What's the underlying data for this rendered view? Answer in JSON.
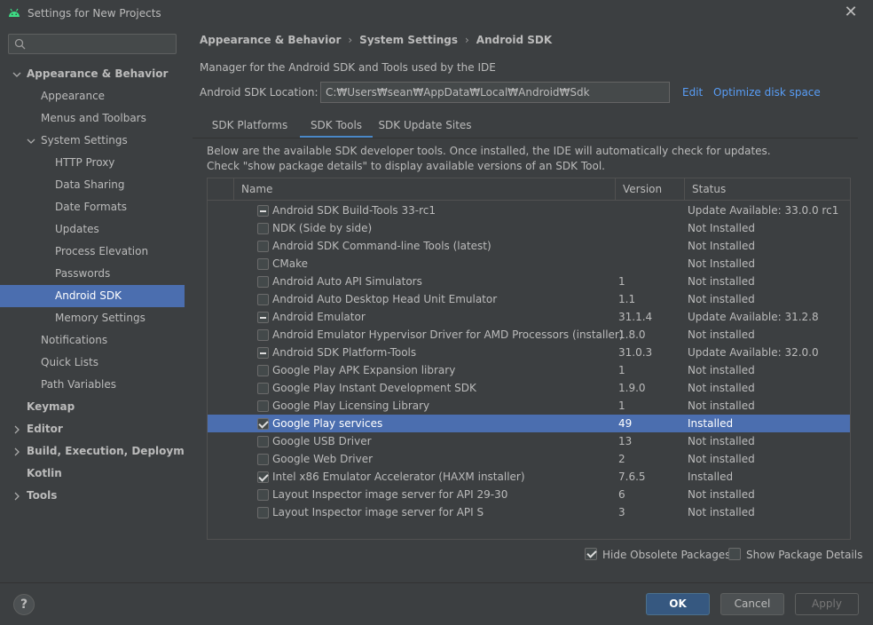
{
  "window": {
    "title": "Settings for New Projects"
  },
  "sidebar": {
    "items": [
      {
        "label": "Appearance & Behavior",
        "level": 0,
        "bold": true,
        "arrow": "down"
      },
      {
        "label": "Appearance",
        "level": 1
      },
      {
        "label": "Menus and Toolbars",
        "level": 1
      },
      {
        "label": "System Settings",
        "level": 1,
        "arrow": "down"
      },
      {
        "label": "HTTP Proxy",
        "level": 2
      },
      {
        "label": "Data Sharing",
        "level": 2
      },
      {
        "label": "Date Formats",
        "level": 2
      },
      {
        "label": "Updates",
        "level": 2
      },
      {
        "label": "Process Elevation",
        "level": 2
      },
      {
        "label": "Passwords",
        "level": 2
      },
      {
        "label": "Android SDK",
        "level": 2,
        "selected": true
      },
      {
        "label": "Memory Settings",
        "level": 2
      },
      {
        "label": "Notifications",
        "level": 1
      },
      {
        "label": "Quick Lists",
        "level": 1
      },
      {
        "label": "Path Variables",
        "level": 1
      },
      {
        "label": "Keymap",
        "level": 0,
        "bold": true
      },
      {
        "label": "Editor",
        "level": 0,
        "bold": true,
        "arrow": "right"
      },
      {
        "label": "Build, Execution, Deployment",
        "level": 0,
        "bold": true,
        "arrow": "right"
      },
      {
        "label": "Kotlin",
        "level": 0,
        "bold": true
      },
      {
        "label": "Tools",
        "level": 0,
        "bold": true,
        "arrow": "right"
      }
    ]
  },
  "breadcrumb": [
    "Appearance & Behavior",
    "System Settings",
    "Android SDK"
  ],
  "description": "Manager for the Android SDK and Tools used by the IDE",
  "sdk_location": {
    "label": "Android SDK Location:",
    "value": "C:₩Users₩sean₩AppData₩Local₩Android₩Sdk",
    "edit": "Edit",
    "optimize": "Optimize disk space"
  },
  "tabs": [
    {
      "label": "SDK Platforms",
      "active": false
    },
    {
      "label": "SDK Tools",
      "active": true
    },
    {
      "label": "SDK Update Sites",
      "active": false
    }
  ],
  "hint_lines": [
    "Below are the available SDK developer tools. Once installed, the IDE will automatically check for updates.",
    "Check \"show package details\" to display available versions of an SDK Tool."
  ],
  "table": {
    "columns": [
      "Name",
      "Version",
      "Status"
    ],
    "rows": [
      {
        "state": "partial",
        "name": "Android SDK Build-Tools 33-rc1",
        "version": "",
        "status": "Update Available: 33.0.0 rc1"
      },
      {
        "state": "empty",
        "name": "NDK (Side by side)",
        "version": "",
        "status": "Not Installed"
      },
      {
        "state": "empty",
        "name": "Android SDK Command-line Tools (latest)",
        "version": "",
        "status": "Not Installed"
      },
      {
        "state": "empty",
        "name": "CMake",
        "version": "",
        "status": "Not Installed"
      },
      {
        "state": "empty",
        "name": "Android Auto API Simulators",
        "version": "1",
        "status": "Not installed"
      },
      {
        "state": "empty",
        "name": "Android Auto Desktop Head Unit Emulator",
        "version": "1.1",
        "status": "Not installed"
      },
      {
        "state": "partial",
        "name": "Android Emulator",
        "version": "31.1.4",
        "status": "Update Available: 31.2.8"
      },
      {
        "state": "empty",
        "name": "Android Emulator Hypervisor Driver for AMD Processors (installer)",
        "version": "1.8.0",
        "status": "Not installed"
      },
      {
        "state": "partial",
        "name": "Android SDK Platform-Tools",
        "version": "31.0.3",
        "status": "Update Available: 32.0.0"
      },
      {
        "state": "empty",
        "name": "Google Play APK Expansion library",
        "version": "1",
        "status": "Not installed"
      },
      {
        "state": "empty",
        "name": "Google Play Instant Development SDK",
        "version": "1.9.0",
        "status": "Not installed"
      },
      {
        "state": "empty",
        "name": "Google Play Licensing Library",
        "version": "1",
        "status": "Not installed"
      },
      {
        "state": "checked",
        "name": "Google Play services",
        "version": "49",
        "status": "Installed",
        "selected": true
      },
      {
        "state": "empty",
        "name": "Google USB Driver",
        "version": "13",
        "status": "Not installed"
      },
      {
        "state": "empty",
        "name": "Google Web Driver",
        "version": "2",
        "status": "Not installed"
      },
      {
        "state": "checked",
        "name": "Intel x86 Emulator Accelerator (HAXM installer)",
        "version": "7.6.5",
        "status": "Installed"
      },
      {
        "state": "empty",
        "name": "Layout Inspector image server for API 29-30",
        "version": "6",
        "status": "Not installed"
      },
      {
        "state": "empty",
        "name": "Layout Inspector image server for API S",
        "version": "3",
        "status": "Not installed"
      }
    ]
  },
  "options": {
    "hide_obsolete": {
      "label": "Hide Obsolete Packages",
      "checked": true
    },
    "show_details": {
      "label": "Show Package Details",
      "checked": false
    }
  },
  "footer": {
    "help": "?",
    "ok": "OK",
    "cancel": "Cancel",
    "apply": "Apply"
  },
  "colors": {
    "selection": "#4b6eaf",
    "link": "#589df6",
    "background": "#3c3f41",
    "accent_tab": "#4a88c7"
  }
}
